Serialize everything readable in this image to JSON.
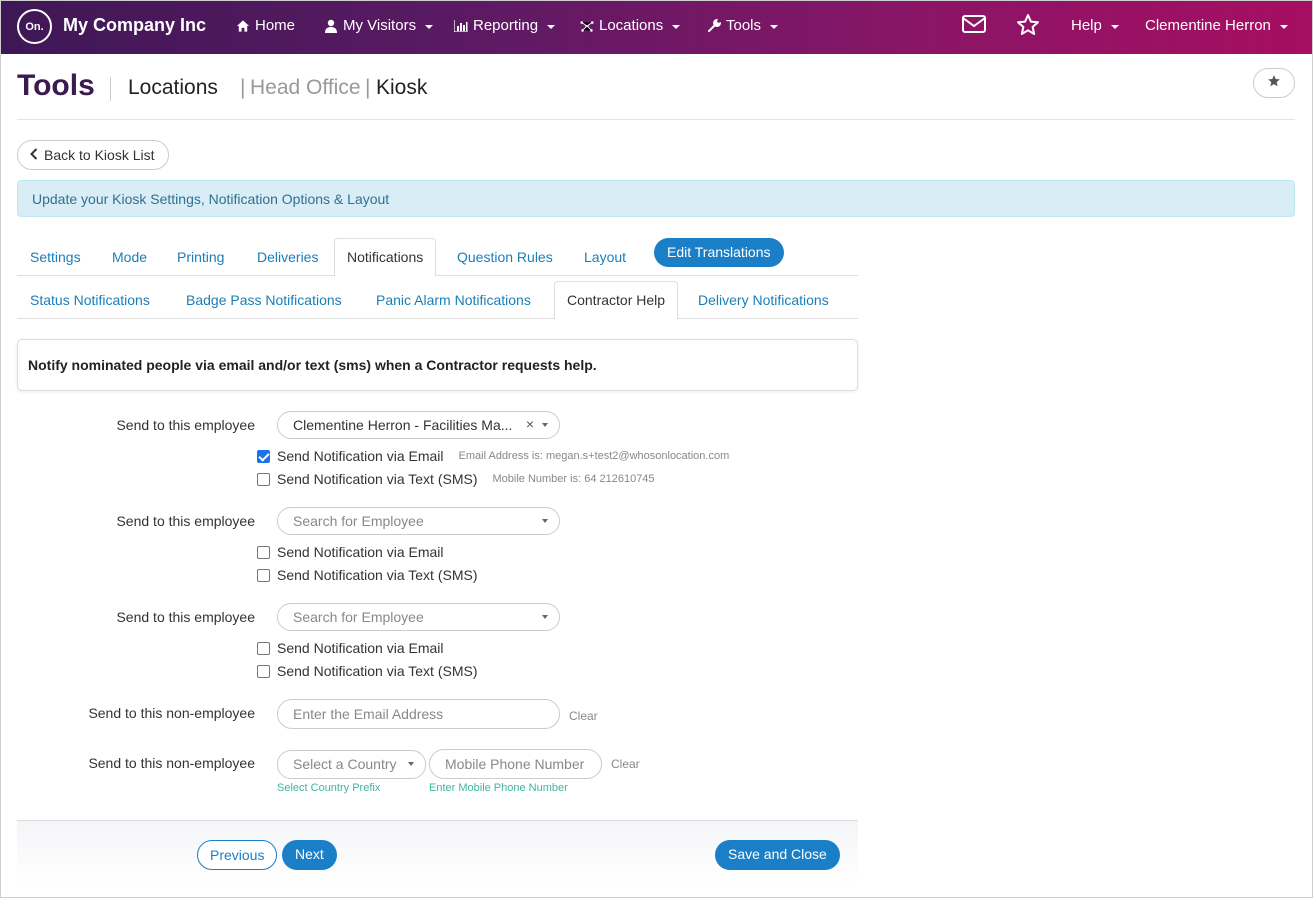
{
  "nav": {
    "logo": "On.",
    "company": "My Company Inc",
    "home": "Home",
    "visitors": "My Visitors",
    "reporting": "Reporting",
    "locations": "Locations",
    "tools": "Tools",
    "help": "Help",
    "user": "Clementine Herron"
  },
  "header": {
    "title": "Tools",
    "crumb_locations": "Locations",
    "sep1": "|",
    "crumb_office": "Head Office",
    "sep2": "|",
    "crumb_kiosk": "Kiosk"
  },
  "back_label": "Back to Kiosk List",
  "info_text": "Update your Kiosk Settings, Notification Options & Layout",
  "tabs": [
    "Settings",
    "Mode",
    "Printing",
    "Deliveries",
    "Notifications",
    "Question Rules",
    "Layout"
  ],
  "edit_translations": "Edit Translations",
  "subtabs": [
    "Status Notifications",
    "Badge Pass Notifications",
    "Panic Alarm Notifications",
    "Contractor Help",
    "Delivery Notifications"
  ],
  "panel_text": "Notify nominated people via email and/or text (sms) when a Contractor requests help.",
  "employee_label": "Send to this employee",
  "non_employee_label": "Send to this non-employee",
  "employees": [
    {
      "selected": "Clementine Herron - Facilities Ma...",
      "email_label": "Send Notification via Email",
      "email_checked": true,
      "email_hint": "Email Address is: megan.s+test2@whosonlocation.com",
      "sms_label": "Send Notification via Text (SMS)",
      "sms_checked": false,
      "sms_hint": "Mobile Number is: 64 212610745"
    },
    {
      "placeholder": "Search for Employee",
      "email_label": "Send Notification via Email",
      "email_checked": false,
      "sms_label": "Send Notification via Text (SMS)",
      "sms_checked": false
    },
    {
      "placeholder": "Search for Employee",
      "email_label": "Send Notification via Email",
      "email_checked": false,
      "sms_label": "Send Notification via Text (SMS)",
      "sms_checked": false
    }
  ],
  "non_employee": {
    "email_placeholder": "Enter the Email Address",
    "clear": "Clear",
    "country_placeholder": "Select a Country",
    "phone_placeholder": "Mobile Phone Number",
    "country_hint": "Select Country Prefix",
    "phone_hint": "Enter Mobile Phone Number"
  },
  "footer": {
    "previous": "Previous",
    "next": "Next",
    "save": "Save and Close"
  },
  "colors": {
    "accent": "#1a7fc7",
    "nav_start": "#3f1756",
    "nav_end": "#a60e62",
    "title": "#3a1a4f"
  }
}
